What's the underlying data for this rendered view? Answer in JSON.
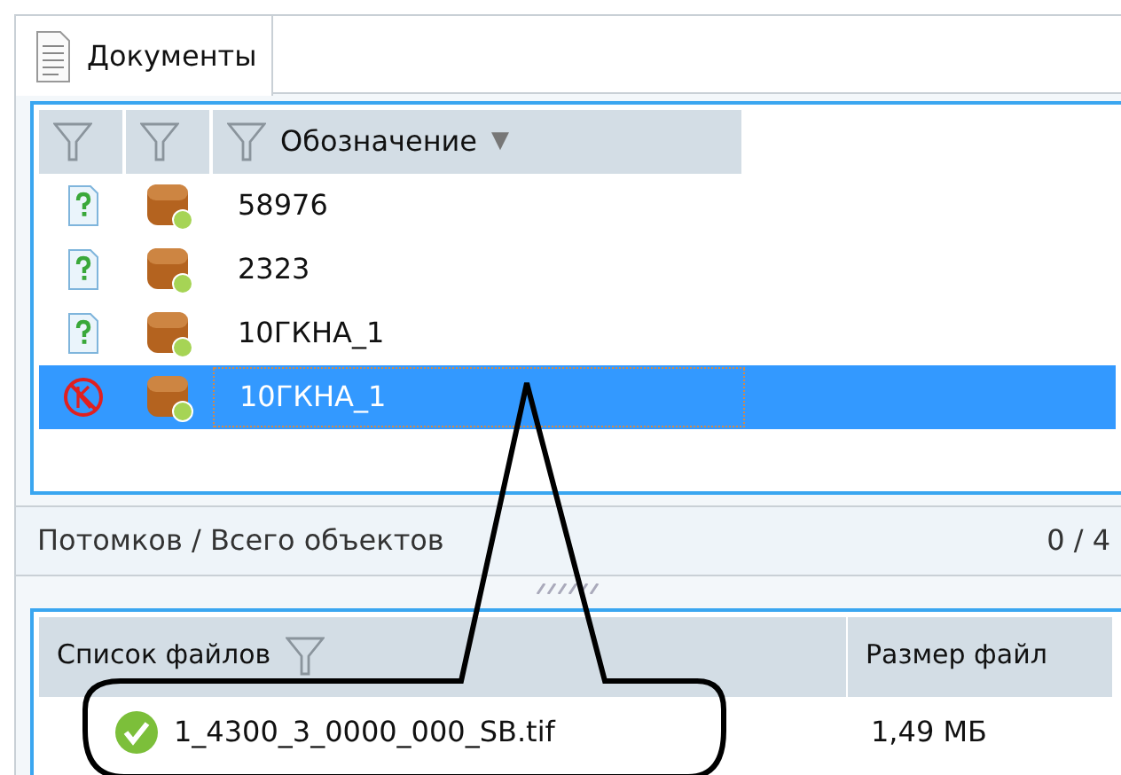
{
  "tab": {
    "label": "Документы",
    "selected": true
  },
  "objects": {
    "columns": [
      {
        "kind": "filter"
      },
      {
        "kind": "filter"
      },
      {
        "kind": "filter",
        "label": "Обозначение",
        "sort": "▼"
      }
    ],
    "rows": [
      {
        "kind": "unknown",
        "name": "58976",
        "selected": false
      },
      {
        "kind": "unknown",
        "name": "2323",
        "selected": false
      },
      {
        "kind": "unknown",
        "name": "10ГКНА_1",
        "selected": false
      },
      {
        "kind": "blocked",
        "name": "10ГКНА_1",
        "selected": true
      }
    ]
  },
  "status_bar": {
    "label": "Потомков / Всего объектов",
    "count": "0 / 4"
  },
  "files": {
    "columns": [
      "Список файлов",
      "Размер файл"
    ],
    "rows": [
      {
        "name": "1_4300_3_0000_000_SB.tif",
        "size": "1,49 МБ"
      }
    ]
  }
}
